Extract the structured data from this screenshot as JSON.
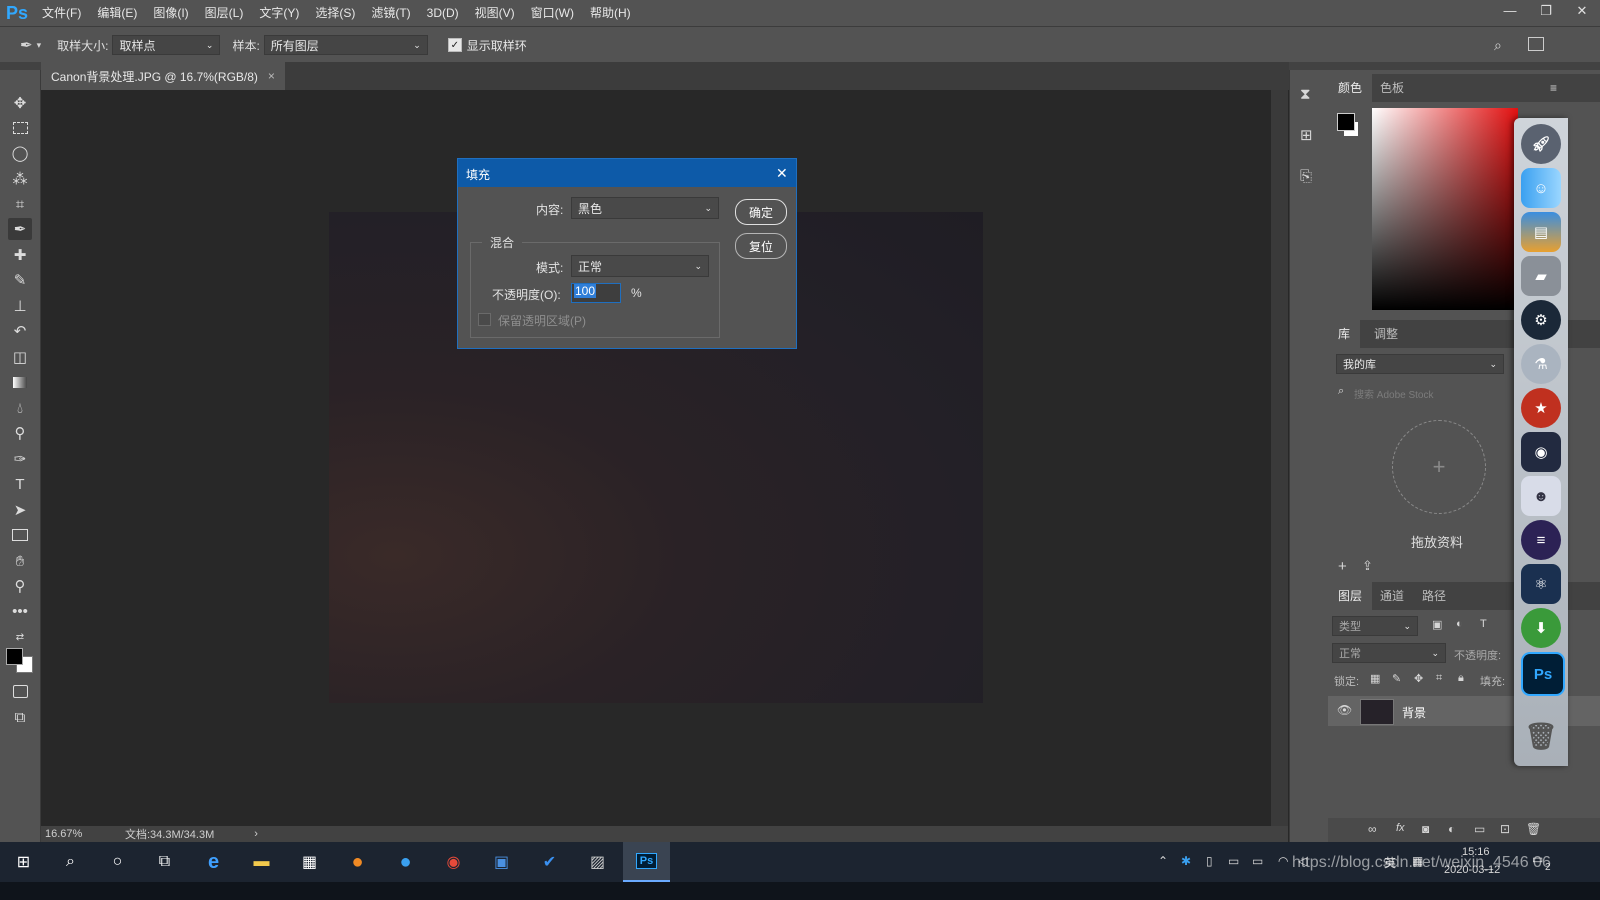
{
  "app": {
    "logo": "Ps"
  },
  "menu": [
    "文件(F)",
    "编辑(E)",
    "图像(I)",
    "图层(L)",
    "文字(Y)",
    "选择(S)",
    "滤镜(T)",
    "3D(D)",
    "视图(V)",
    "窗口(W)",
    "帮助(H)"
  ],
  "window_controls": {
    "minimize": "—",
    "restore": "❐",
    "close": "✕"
  },
  "options": {
    "tool_icon": "eyedropper-icon",
    "sample_size_label": "取样大小:",
    "sample_size_value": "取样点",
    "sample_label": "样本:",
    "sample_value": "所有图层",
    "show_ring_label": "显示取样环",
    "show_ring_checked": true
  },
  "document": {
    "tab_title": "Canon背景处理.JPG @ 16.7%(RGB/8)",
    "tab_close": "×",
    "zoom": "16.67%",
    "doc_size": "文档:34.3M/34.3M",
    "status_arrow": "›"
  },
  "dialog": {
    "title": "填充",
    "close": "✕",
    "content_label": "内容:",
    "content_value": "黑色",
    "ok_label": "确定",
    "reset_label": "复位",
    "blend_group_label": "混合",
    "mode_label": "模式:",
    "mode_value": "正常",
    "opacity_label": "不透明度(O):",
    "opacity_value": "100",
    "opacity_unit": "%",
    "preserve_label": "保留透明区域(P)"
  },
  "panels": {
    "color_tabs": [
      "颜色",
      "色板"
    ],
    "library_tabs": [
      "库",
      "调整"
    ],
    "library_select": "我的库",
    "library_search_placeholder": "搜索 Adobe Stock",
    "library_drop_label": "拖放资料",
    "layers_tabs": [
      "图层",
      "通道",
      "路径"
    ],
    "layers_filter": "类型",
    "blend_mode": "正常",
    "opacity_label": "不透明度:",
    "lock_label": "锁定:",
    "fill_label": "填充:",
    "layer_name": "背景"
  },
  "taskbar": {
    "time": "15:16",
    "date": "2020-03-12",
    "ime": "英",
    "notify_count": "2",
    "watermark": "https://blog.csdn.net/weixin_4546 06"
  },
  "colors": {
    "accent": "#31a8ff",
    "dialog_title": "#0d5aa8",
    "foreground": "#000000",
    "background": "#ffffff"
  }
}
